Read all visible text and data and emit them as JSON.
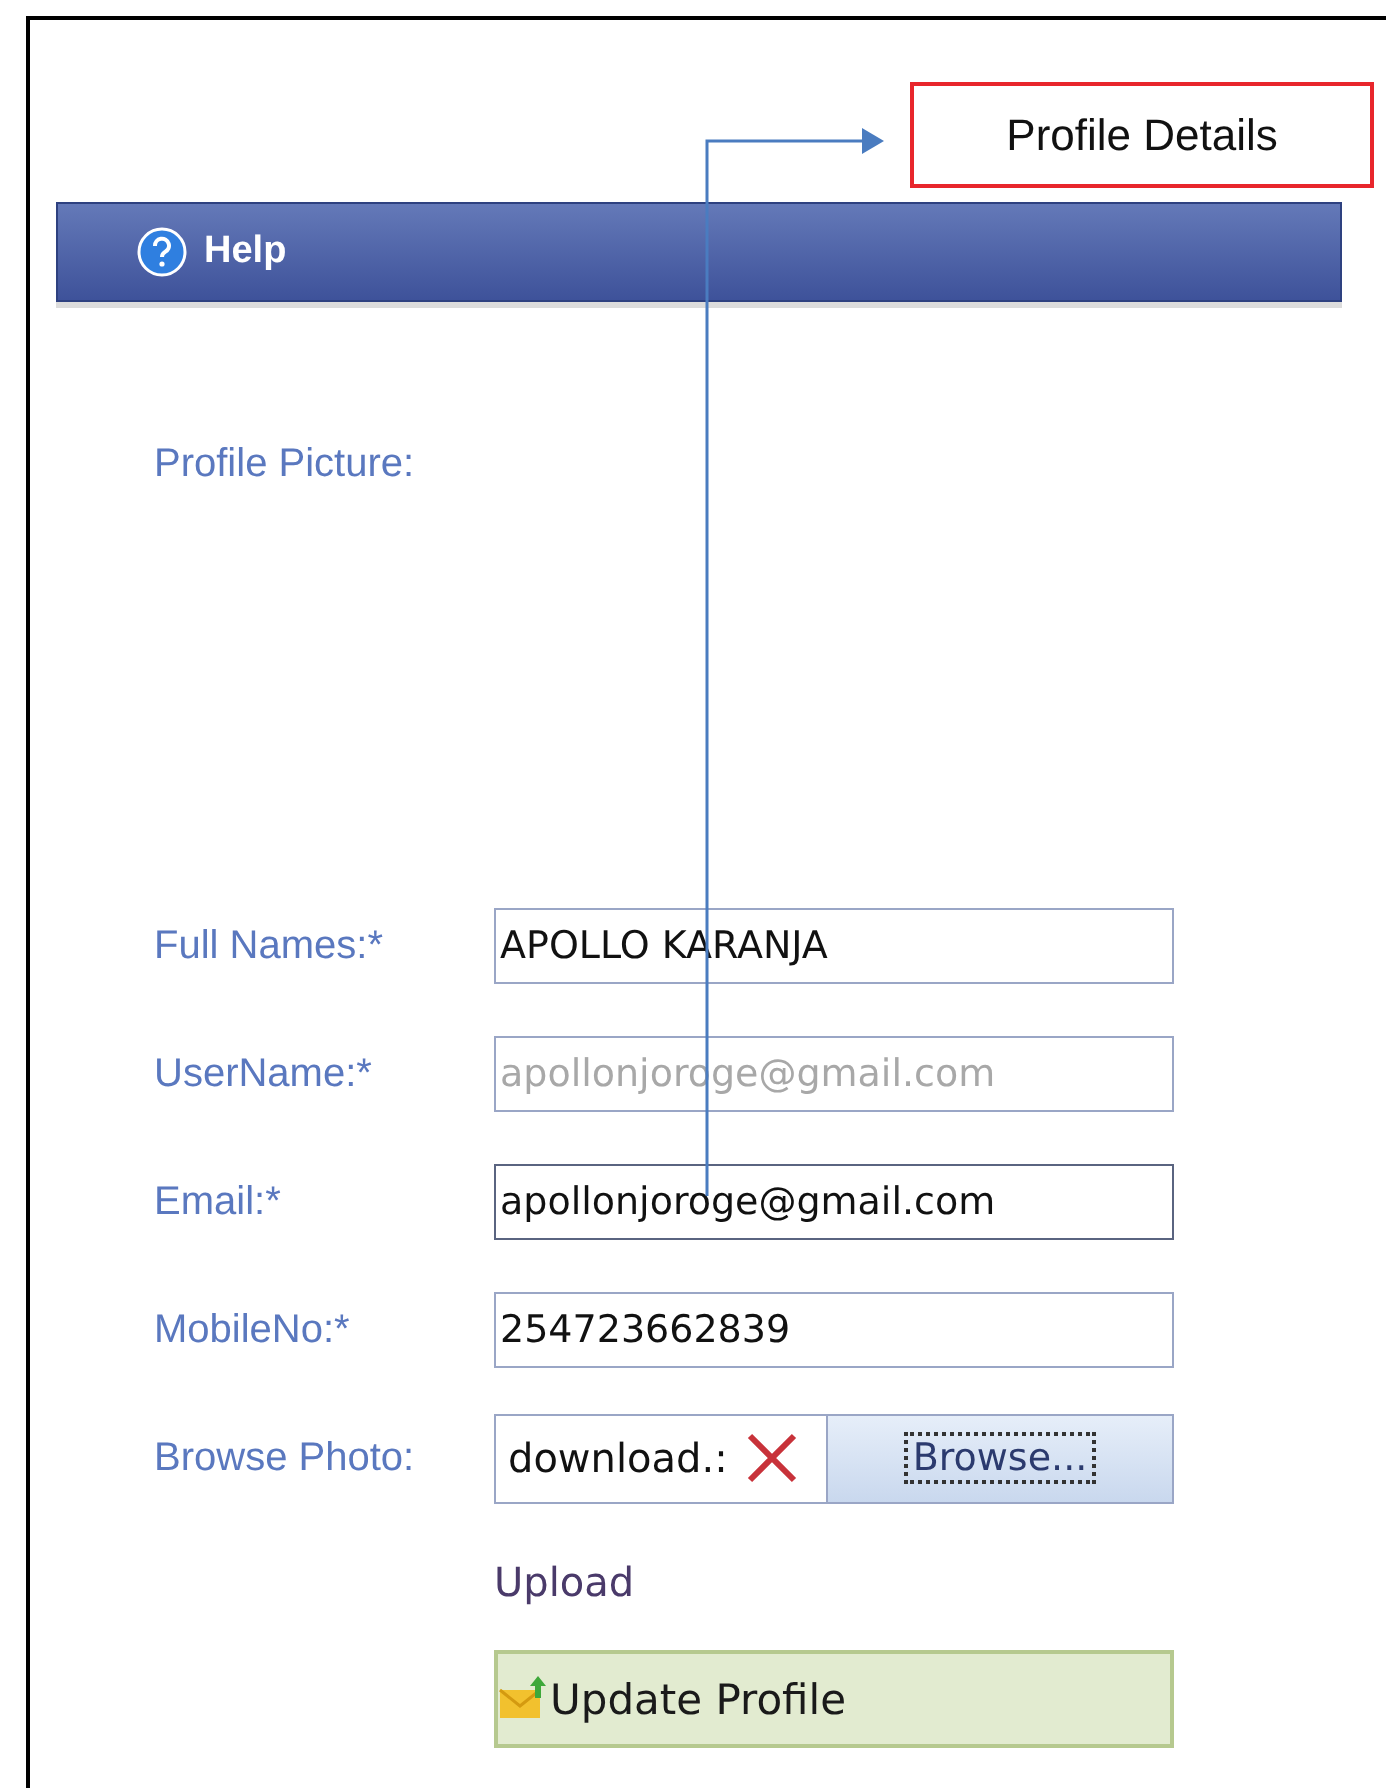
{
  "callout": {
    "label": "Profile Details"
  },
  "header": {
    "help": "Help"
  },
  "profile_picture": {
    "label": "Profile Picture:"
  },
  "fields": [
    {
      "label": "Full Names:*",
      "value": "APOLLO KARANJA",
      "disabled": false
    },
    {
      "label": "UserName:*",
      "value": "apollonjoroge@gmail.com",
      "disabled": true
    },
    {
      "label": "Email:*",
      "value": "apollonjoroge@gmail.com",
      "disabled": false
    },
    {
      "label": "MobileNo:*",
      "value": "254723662839",
      "disabled": false
    }
  ],
  "browse_photo": {
    "label": "Browse Photo:",
    "file_name": "download.:",
    "button": "Browse..."
  },
  "upload_label": "Upload",
  "submit": "Update Profile"
}
